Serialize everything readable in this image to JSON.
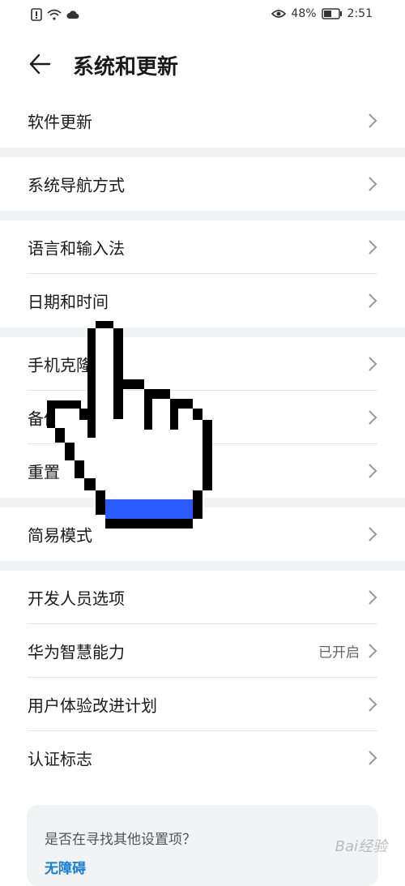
{
  "status_bar": {
    "battery": "48%",
    "time": "2:51",
    "icons": [
      "alert-icon",
      "wifi-icon",
      "cloud-icon",
      "eye-icon",
      "battery-icon"
    ]
  },
  "header": {
    "title": "系统和更新",
    "back_icon": "back-arrow-icon"
  },
  "groups": [
    {
      "items": [
        {
          "label": "软件更新"
        }
      ]
    },
    {
      "items": [
        {
          "label": "系统导航方式"
        }
      ]
    },
    {
      "items": [
        {
          "label": "语言和输入法"
        },
        {
          "label": "日期和时间"
        }
      ]
    },
    {
      "items": [
        {
          "label": "手机克隆"
        },
        {
          "label": "备份和恢复"
        },
        {
          "label": "重置"
        }
      ]
    },
    {
      "items": [
        {
          "label": "简易模式"
        }
      ]
    },
    {
      "items": [
        {
          "label": "开发人员选项"
        },
        {
          "label": "华为智慧能力",
          "value": "已开启"
        },
        {
          "label": "用户体验改进计划"
        },
        {
          "label": "认证标志"
        }
      ]
    }
  ],
  "suggestion_card": {
    "question": "是否在寻找其他设置项？",
    "link": "无障碍"
  },
  "colors": {
    "page_bg": "#ffffff",
    "separator": "#f1f3f5",
    "link": "#1a7ed8",
    "hand_fill": "#2a5cff"
  },
  "watermark": "Bai经验"
}
